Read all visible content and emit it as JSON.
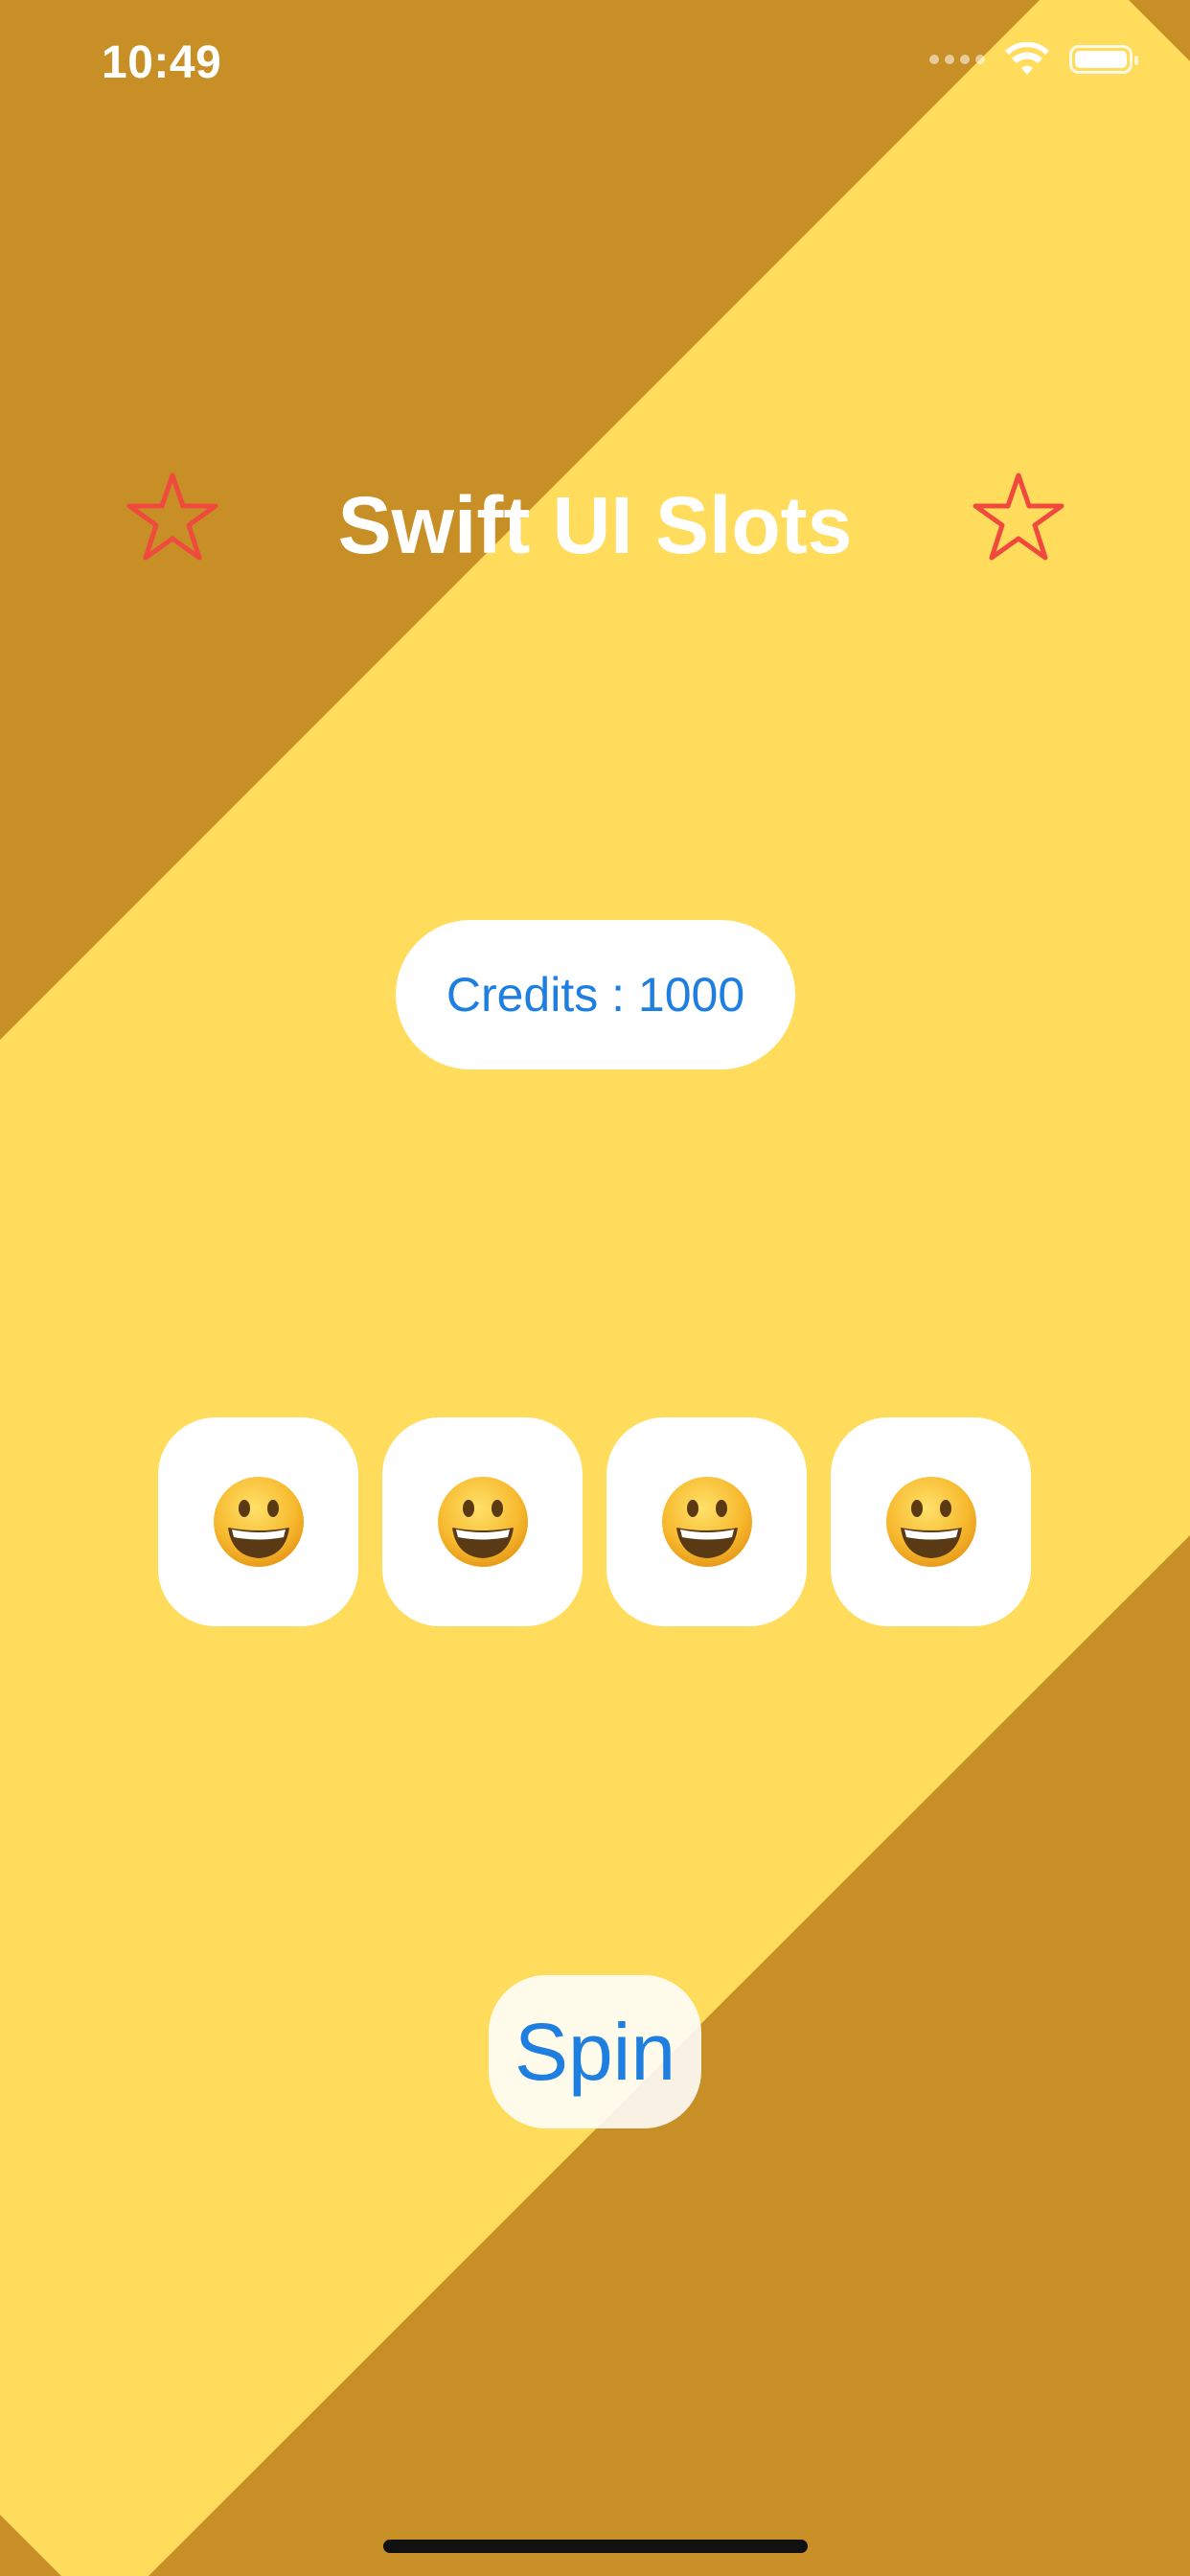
{
  "status_bar": {
    "time": "10:49",
    "icons": [
      "cellular-signal-icon",
      "wifi-icon",
      "battery-icon"
    ]
  },
  "header": {
    "title": "Swift UI Slots",
    "left_icon": "star-outline-icon",
    "right_icon": "star-outline-icon"
  },
  "credits": {
    "label": "Credits : 1000"
  },
  "slots": [
    {
      "symbol": "grinning-face-emoji"
    },
    {
      "symbol": "grinning-face-emoji"
    },
    {
      "symbol": "grinning-face-emoji"
    },
    {
      "symbol": "grinning-face-emoji"
    }
  ],
  "spin_button": {
    "label": "Spin"
  },
  "colors": {
    "background_dark": "#C78F25",
    "background_light": "#FFDC5B",
    "accent_blue": "#1E7FE0",
    "star_red": "#F04A3E"
  }
}
